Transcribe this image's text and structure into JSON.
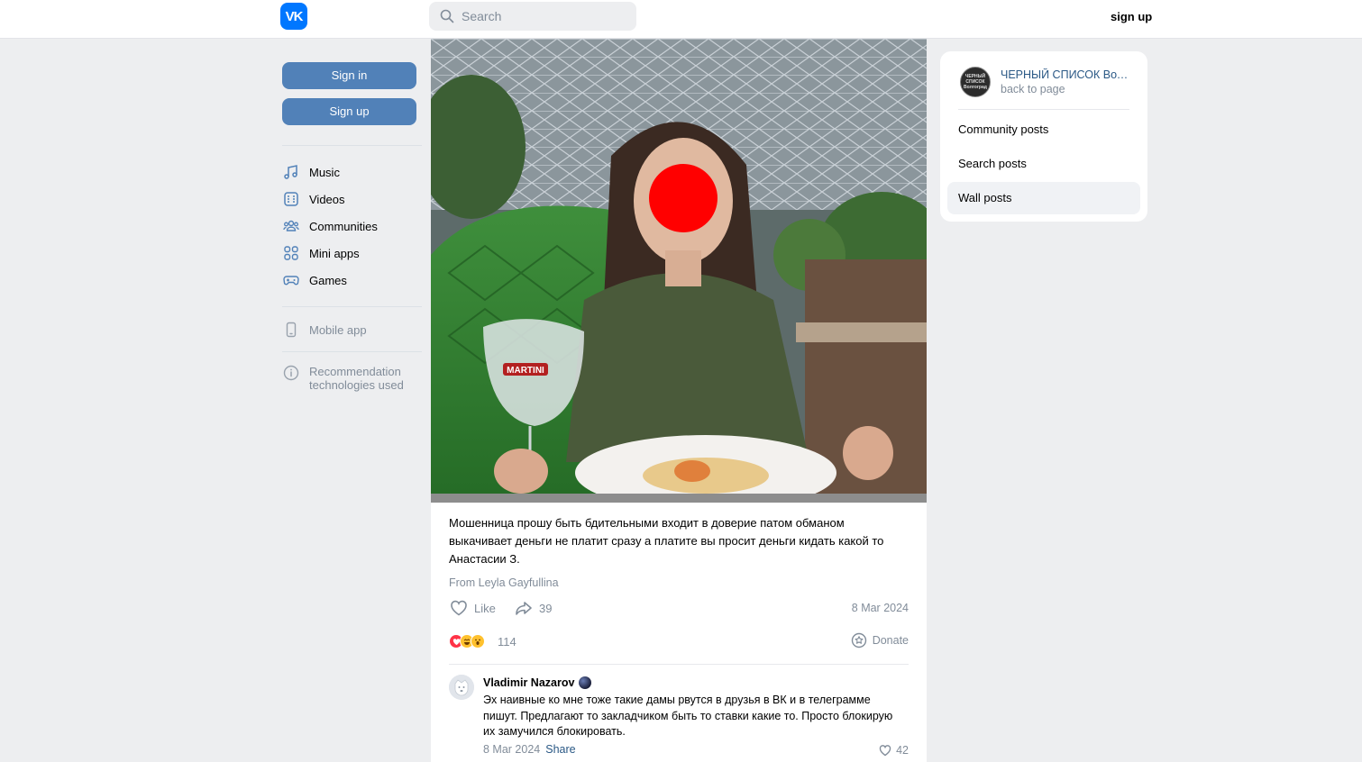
{
  "header": {
    "logo_text": "VK",
    "search_placeholder": "Search",
    "signup_label": "sign up"
  },
  "leftnav": {
    "signin_label": "Sign in",
    "signup_label": "Sign up",
    "items": [
      {
        "label": "Music",
        "icon": "music-icon"
      },
      {
        "label": "Videos",
        "icon": "videos-icon"
      },
      {
        "label": "Communities",
        "icon": "communities-icon"
      },
      {
        "label": "Mini apps",
        "icon": "mini-apps-icon"
      },
      {
        "label": "Games",
        "icon": "games-icon"
      }
    ],
    "mobile_app": "Mobile app",
    "recommendation": "Recommendation technologies used"
  },
  "post": {
    "text": "Мошенница прошу быть бдительными входит в доверие патом обманом выкачивает деньги не платит сразу а платите вы просит деньги кидать какой то Анастасии З.",
    "from": "From Leyla Gayfullina",
    "like_label": "Like",
    "share_count": "39",
    "date": "8 Mar 2024",
    "reactions_count": "114",
    "donate_label": "Donate"
  },
  "comment": {
    "author": "Vladimir Nazarov",
    "text": "Эх наивные ко мне тоже такие дамы рвутся в друзья в ВК и в телеграмме пишут. Предлагают то закладчиком быть то ставки какие то. Просто блокирую их замучился блокировать.",
    "date": "8 Mar 2024",
    "share_label": "Share",
    "likes": "42"
  },
  "rightbox": {
    "avatar_text": "ЧЕРНЫЙ СПИСОК Волгоград",
    "title": "ЧЕРНЫЙ СПИСОК Волгоград",
    "back_label": "back to page",
    "items": [
      {
        "label": "Community posts"
      },
      {
        "label": "Search posts"
      },
      {
        "label": "Wall posts",
        "active": true
      }
    ]
  },
  "colors": {
    "accent": "#5181b8",
    "link": "#2a5885",
    "muted": "#818c99",
    "background": "#edeef0",
    "censor_dot": "#ff0000"
  }
}
